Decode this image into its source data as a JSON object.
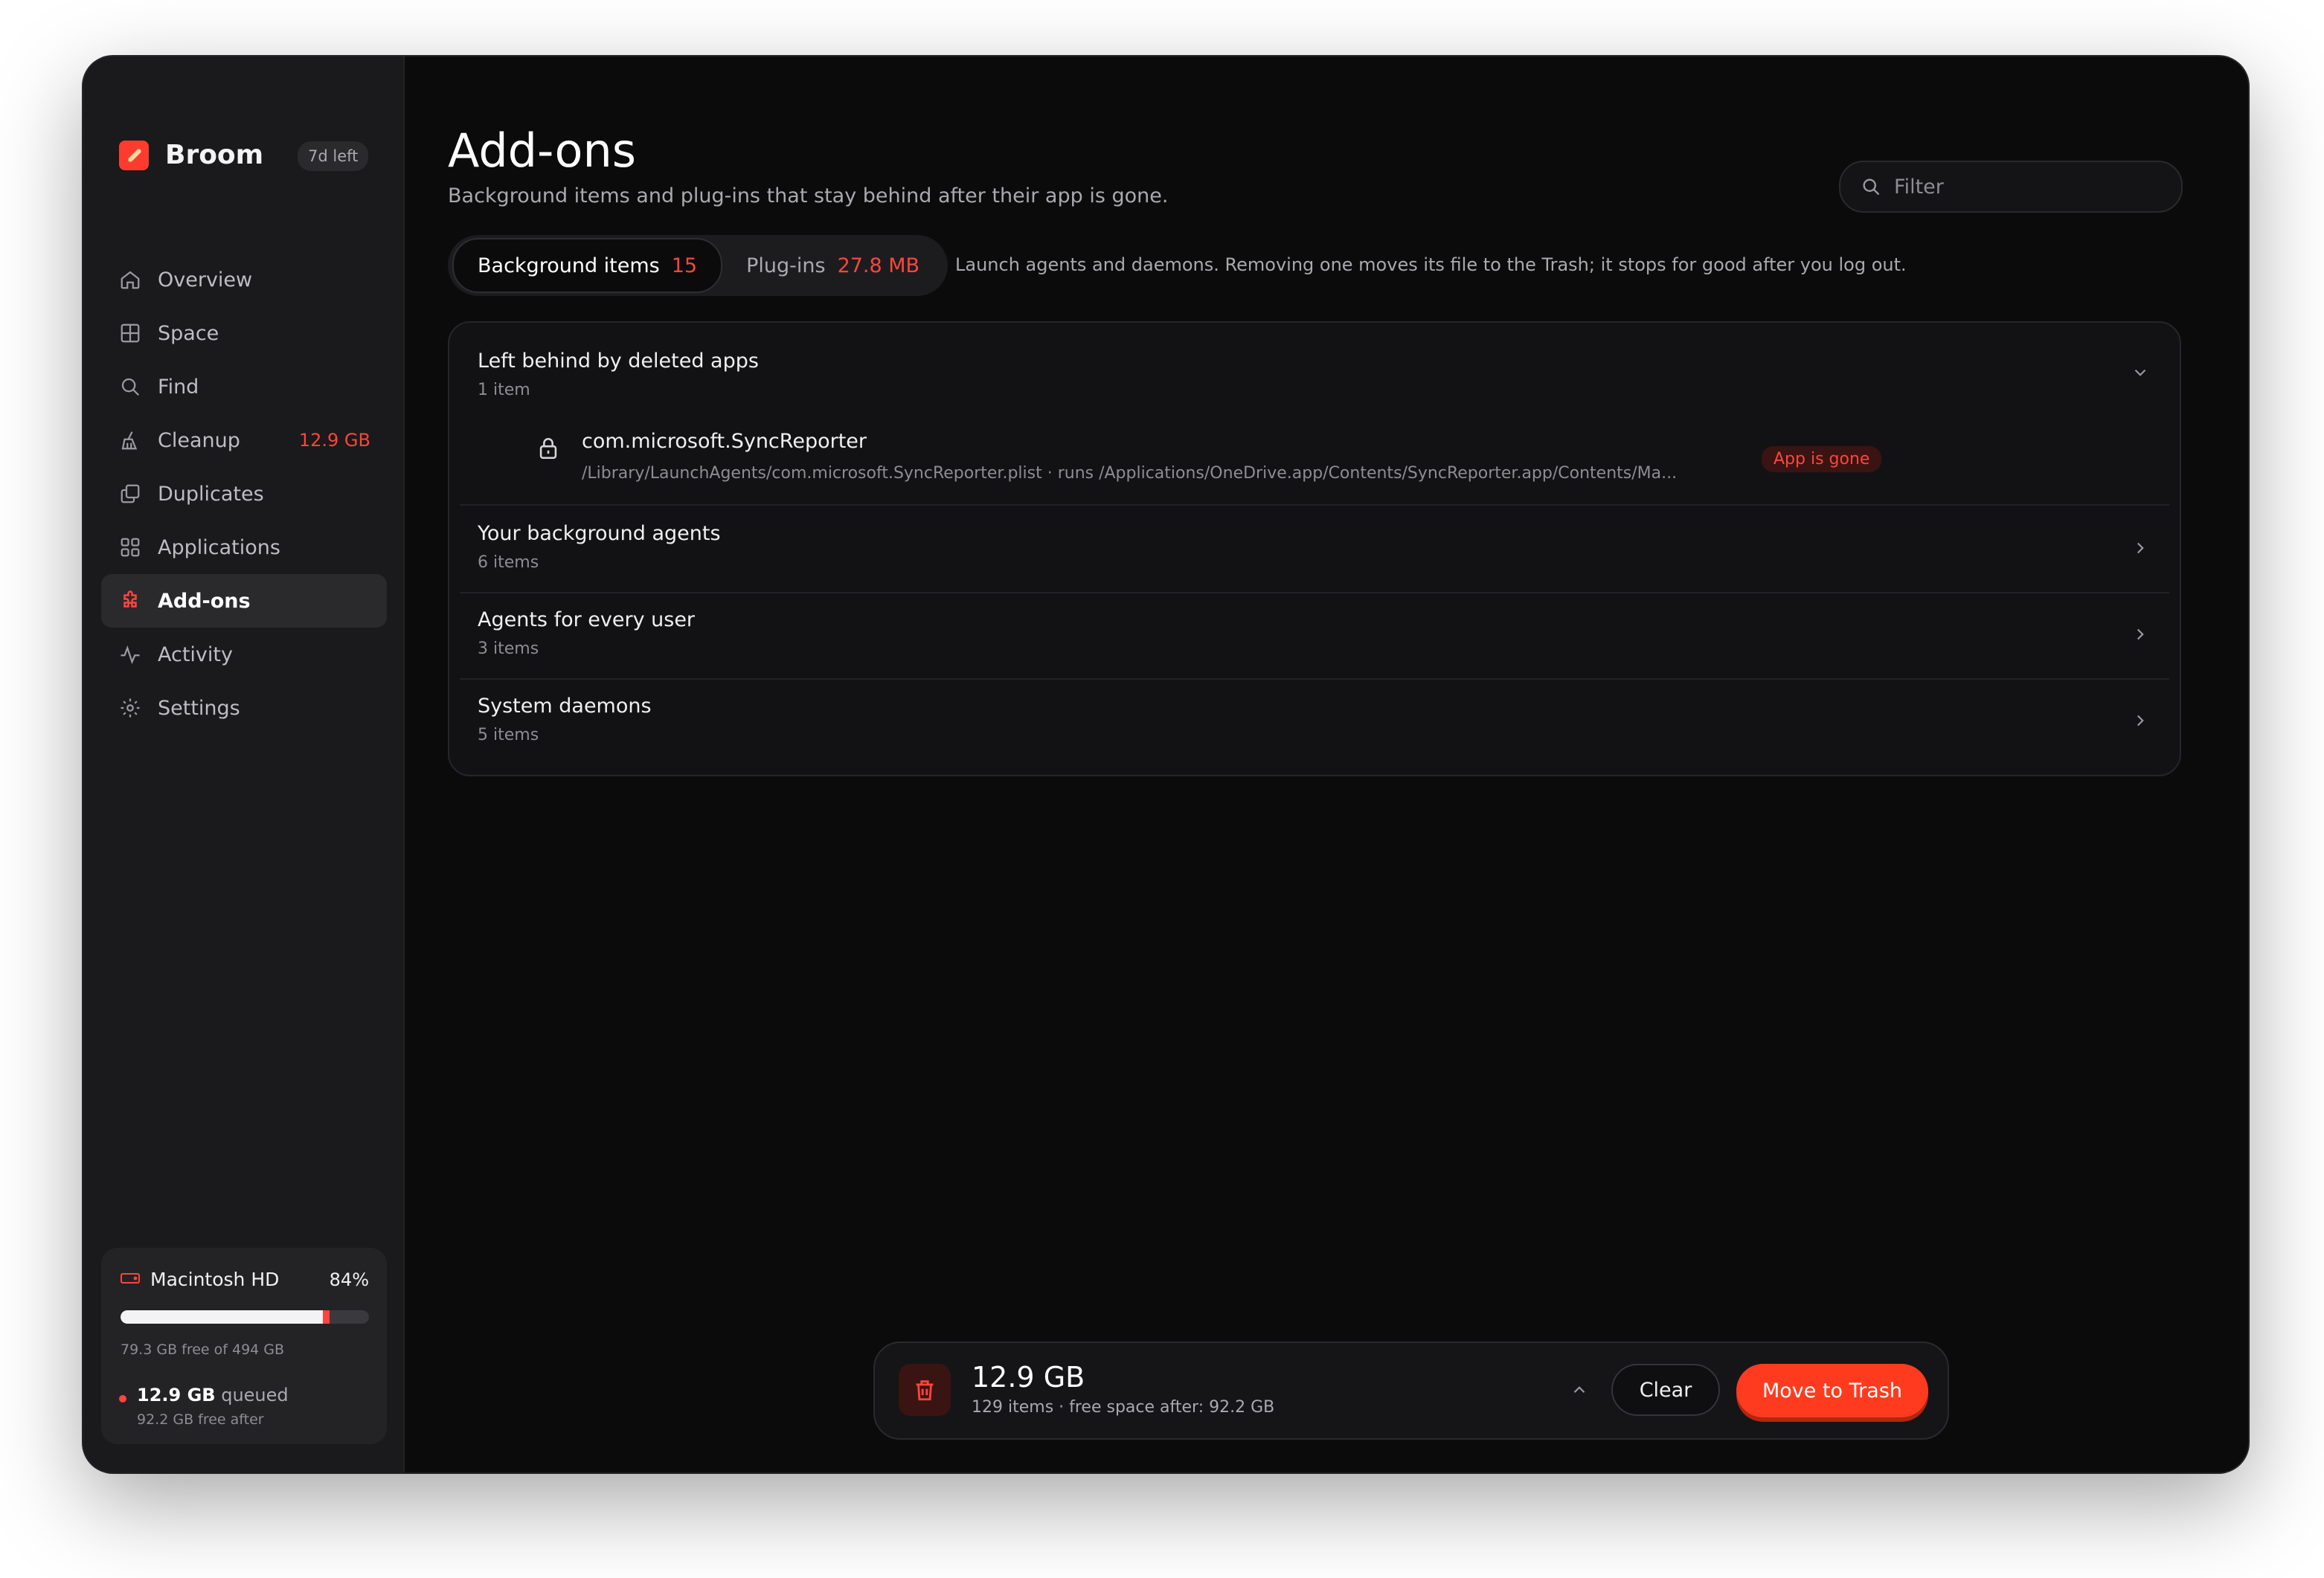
{
  "app": {
    "name": "Broom",
    "trial_badge": "7d left",
    "accent_color": "#ff453a"
  },
  "sidebar": {
    "items": [
      {
        "label": "Overview",
        "icon": "home-icon",
        "active": false,
        "badge": ""
      },
      {
        "label": "Space",
        "icon": "grid-icon",
        "active": false,
        "badge": ""
      },
      {
        "label": "Find",
        "icon": "search-icon",
        "active": false,
        "badge": ""
      },
      {
        "label": "Cleanup",
        "icon": "broom-icon",
        "active": false,
        "badge": "12.9 GB"
      },
      {
        "label": "Duplicates",
        "icon": "copy-icon",
        "active": false,
        "badge": ""
      },
      {
        "label": "Applications",
        "icon": "apps-icon",
        "active": false,
        "badge": ""
      },
      {
        "label": "Add-ons",
        "icon": "puzzle-icon",
        "active": true,
        "badge": ""
      },
      {
        "label": "Activity",
        "icon": "activity-icon",
        "active": false,
        "badge": ""
      },
      {
        "label": "Settings",
        "icon": "gear-icon",
        "active": false,
        "badge": ""
      }
    ]
  },
  "disk": {
    "name": "Macintosh HD",
    "used_percent_label": "84%",
    "used_fraction": 0.84,
    "queued_fraction": 0.026,
    "free_text": "79.3 GB free of 494 GB",
    "queued_value": "12.9 GB",
    "queued_label": "queued",
    "free_after": "92.2 GB free after"
  },
  "page": {
    "title": "Add-ons",
    "subtitle": "Background items and plug-ins that stay behind after their app is gone."
  },
  "filter": {
    "placeholder": "Filter"
  },
  "tabs": [
    {
      "label": "Background items",
      "count": "15",
      "active": true
    },
    {
      "label": "Plug-ins",
      "count": "27.8 MB",
      "active": false
    }
  ],
  "tab_hint": "Launch agents and daemons. Removing one moves its file to the Trash; it stops for good after you log out.",
  "groups": [
    {
      "title": "Left behind by deleted apps",
      "count": "1 item",
      "expanded": true,
      "items": [
        {
          "name": "com.microsoft.SyncReporter",
          "path": "/Library/LaunchAgents/com.microsoft.SyncReporter.plist · runs /Applications/OneDrive.app/Contents/SyncReporter.app/Contents/Ma...",
          "badge": "App is gone"
        }
      ]
    },
    {
      "title": "Your background agents",
      "count": "6 items",
      "expanded": false
    },
    {
      "title": "Agents for every user",
      "count": "3 items",
      "expanded": false
    },
    {
      "title": "System daemons",
      "count": "5 items",
      "expanded": false
    }
  ],
  "bottom_bar": {
    "size": "12.9 GB",
    "meta": "129 items · free space after: 92.2 GB",
    "clear_label": "Clear",
    "trash_label": "Move to Trash"
  }
}
